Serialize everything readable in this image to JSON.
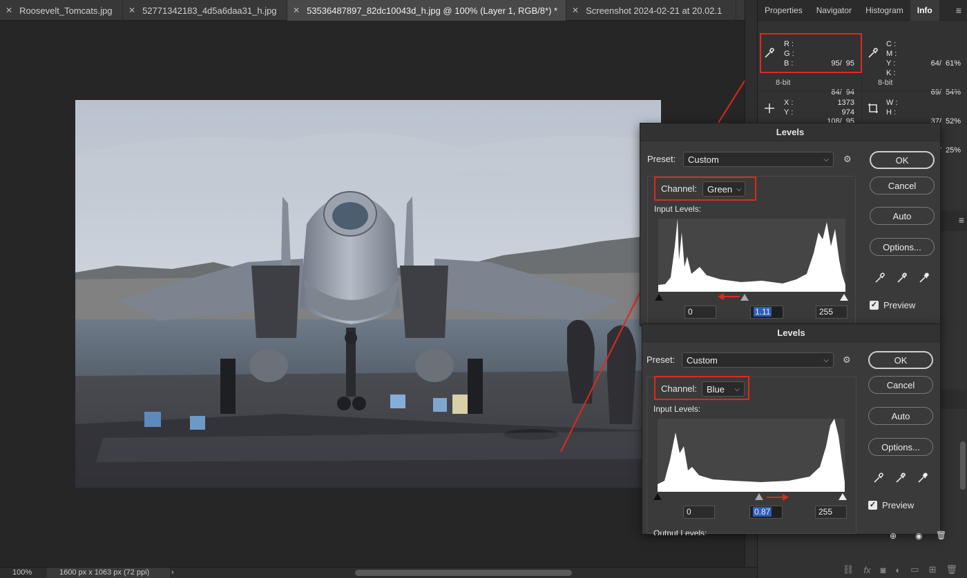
{
  "tabs": [
    {
      "label": "Roosevelt_Tomcats.jpg",
      "active": false
    },
    {
      "label": "52771342183_4d5a6daa31_h.jpg",
      "active": false
    },
    {
      "label": "53536487897_82dc10043d_h.jpg @ 100% (Layer 1, RGB/8*) *",
      "active": true
    },
    {
      "label": "Screenshot 2024-02-21 at 20.02.1",
      "active": false
    }
  ],
  "tab_more": "»",
  "panel_tabs": [
    "Properties",
    "Navigator",
    "Histogram",
    "Info"
  ],
  "panel_menu": "≡",
  "info": {
    "rgb": {
      "r_label": "R :",
      "g_label": "G :",
      "b_label": "B :",
      "r": "95/  95",
      "g": "84/  94",
      "b": "108/  95"
    },
    "cmyk": {
      "c_label": "C :",
      "m_label": "M :",
      "y_label": "Y :",
      "k_label": "K :",
      "c": "64/  61%",
      "m": "69/  54%",
      "y": "37/  52%",
      "k": "18/  25%"
    },
    "bits_left": "8-bit",
    "bits_right": "8-bit",
    "xy": {
      "x_label": "X :",
      "y_label": "Y :",
      "x": "1373",
      "y": "974"
    },
    "wh": {
      "w_label": "W :",
      "h_label": "H :"
    }
  },
  "levels_green": {
    "title": "Levels",
    "preset_label": "Preset:",
    "preset_value": "Custom",
    "channel_label": "Channel:",
    "channel_value": "Green",
    "input_levels_label": "Input Levels:",
    "input_black": "0",
    "input_gamma": "1.11",
    "input_white": "255",
    "buttons": {
      "ok": "OK",
      "cancel": "Cancel",
      "auto": "Auto",
      "options": "Options..."
    },
    "preview_label": "Preview"
  },
  "levels_blue": {
    "title": "Levels",
    "preset_label": "Preset:",
    "preset_value": "Custom",
    "channel_label": "Channel:",
    "channel_value": "Blue",
    "input_levels_label": "Input Levels:",
    "input_black": "0",
    "input_gamma": "0.87",
    "input_white": "255",
    "output_levels_label": "Output Levels:",
    "buttons": {
      "ok": "OK",
      "cancel": "Cancel",
      "auto": "Auto",
      "options": "Options..."
    },
    "preview_label": "Preview"
  },
  "status": {
    "zoom": "100%",
    "dimensions": "1600 px x 1063 px (72 ppi)",
    "chevron": "›"
  },
  "colors": {
    "accent_red": "#e0291d",
    "selection_blue": "#2e5fb8"
  }
}
